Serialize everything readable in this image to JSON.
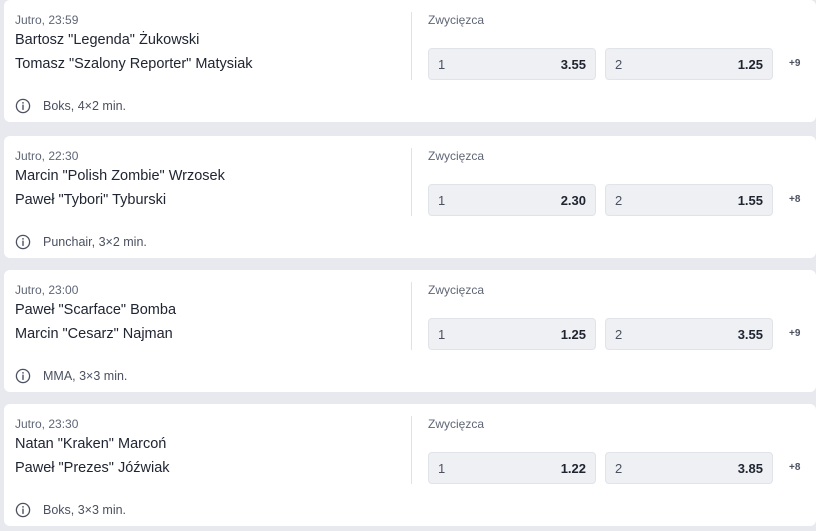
{
  "events": [
    {
      "time": "Jutro, 22:30",
      "fighter1": "Marcin \"Polish Zombie\" Wrzosek",
      "fighter2": "Paweł \"Tybori\" Tyburski",
      "market": "Zwycięzca",
      "odd1": {
        "label": "1",
        "value": "2.30"
      },
      "odd2": {
        "label": "2",
        "value": "1.55"
      },
      "more": "+8",
      "info_icon": "info-circle-icon",
      "info": "Punchair, 3×2 min."
    },
    {
      "time": "Jutro, 23:00",
      "fighter1": "Paweł \"Scarface\" Bomba",
      "fighter2": "Marcin \"Cesarz\" Najman",
      "market": "Zwycięzca",
      "odd1": {
        "label": "1",
        "value": "1.25"
      },
      "odd2": {
        "label": "2",
        "value": "3.55"
      },
      "more": "+9",
      "info_icon": "info-circle-icon",
      "info": "MMA, 3×3 min."
    },
    {
      "time": "Jutro, 23:30",
      "fighter1": "Natan \"Kraken\" Marcoń",
      "fighter2": "Paweł \"Prezes\" Jóźwiak",
      "market": "Zwycięzca",
      "odd1": {
        "label": "1",
        "value": "1.22"
      },
      "odd2": {
        "label": "2",
        "value": "3.85"
      },
      "more": "+8",
      "info_icon": "info-circle-icon",
      "info": "Boks, 3×3 min."
    },
    {
      "time": "Jutro, 23:59",
      "fighter1": "Bartosz \"Legenda\" Żukowski",
      "fighter2": "Tomasz \"Szalony Reporter\" Matysiak",
      "market": "Zwycięzca",
      "odd1": {
        "label": "1",
        "value": "3.55"
      },
      "odd2": {
        "label": "2",
        "value": "1.25"
      },
      "more": "+9",
      "info_icon": "info-circle-icon",
      "info": "Boks, 4×2 min."
    }
  ]
}
